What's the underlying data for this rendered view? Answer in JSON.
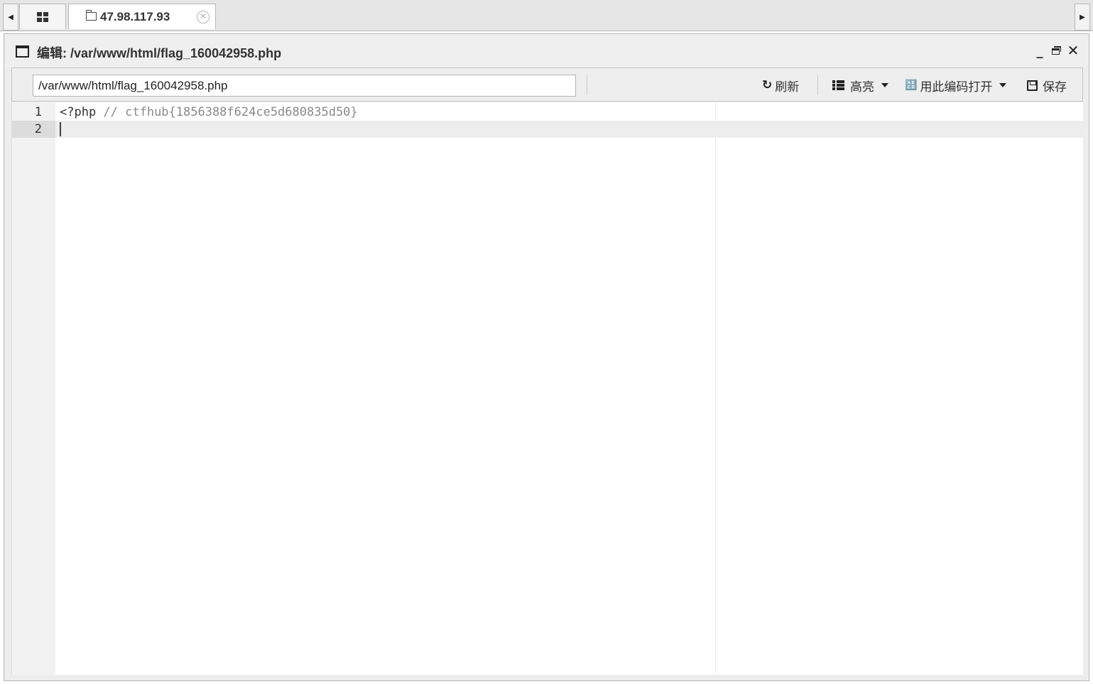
{
  "tabs": {
    "home_tab": {
      "icon": "grid-icon"
    },
    "site_tab": {
      "icon": "folder-icon",
      "label": "47.98.117.93",
      "close_icon": "close-circle-icon"
    },
    "scroll_left_glyph": "◀",
    "scroll_right_glyph": "▶"
  },
  "window": {
    "icon": "window-icon",
    "title": "编辑: /var/www/html/flag_160042958.php",
    "controls": {
      "minimize_glyph": "_",
      "close_glyph": "✕"
    }
  },
  "toolbar": {
    "path_value": "/var/www/html/flag_160042958.php",
    "refresh": {
      "icon": "refresh-icon",
      "glyph": "↻",
      "label": "刷新"
    },
    "highlight": {
      "icon": "list-icon",
      "label": "高亮"
    },
    "encoding": {
      "icon": "encoding-icon",
      "glyph": "🔠",
      "label": "用此编码打开"
    },
    "save": {
      "icon": "save-icon",
      "label": "保存"
    }
  },
  "editor": {
    "lines": [
      {
        "number": "1",
        "tag": "<?php ",
        "comment": "// ctfhub{1856388f624ce5d680835d50}"
      },
      {
        "number": "2",
        "tag": "",
        "comment": ""
      }
    ],
    "active_line": 2
  }
}
